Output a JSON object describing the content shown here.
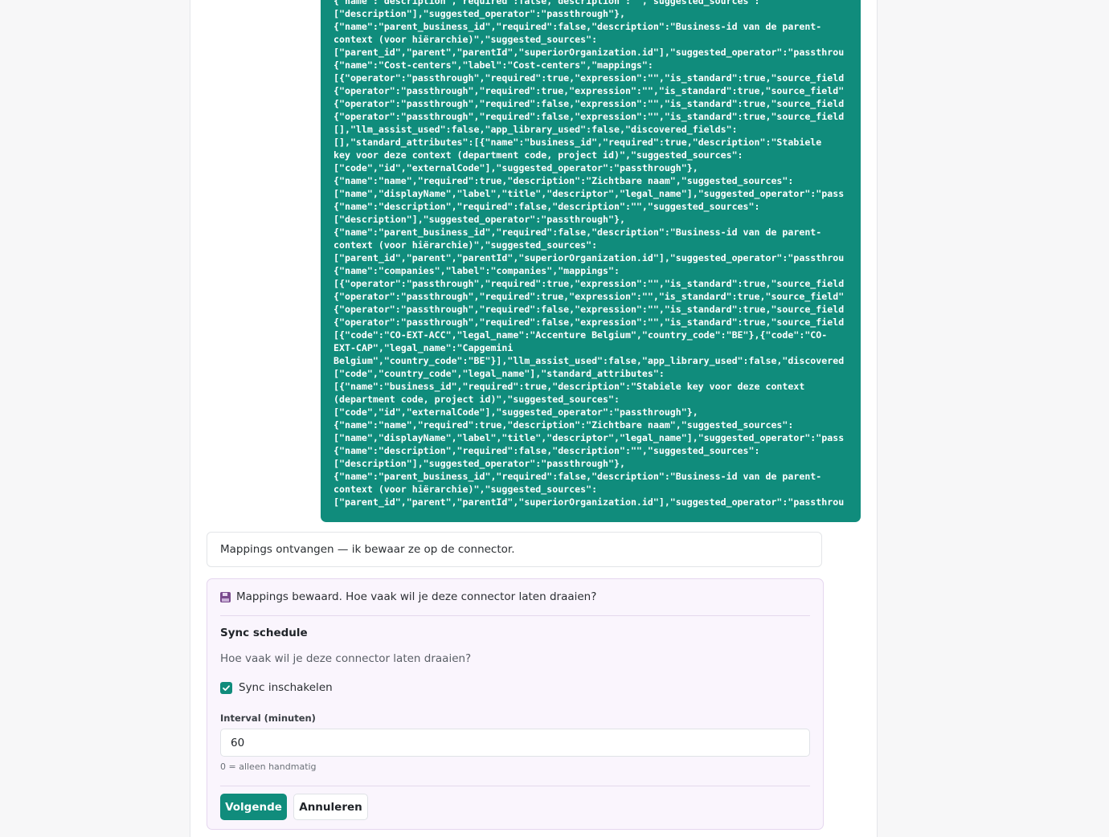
{
  "json_payload": {
    "lines": [
      "{\"name\":\"description\",\"required\":false,\"description\":\"\",\"suggested_sources\":",
      "[\"description\"],\"suggested_operator\":\"passthrough\"},",
      "{\"name\":\"parent_business_id\",\"required\":false,\"description\":\"Business-id van de parent-",
      "context (voor hiërarchie)\",\"suggested_sources\":",
      "[\"parent_id\",\"parent\",\"parentId\",\"superiorOrganization.id\"],\"suggested_operator\":\"passthrou",
      "{\"name\":\"Cost-centers\",\"label\":\"Cost-centers\",\"mappings\":",
      "[{\"operator\":\"passthrough\",\"required\":true,\"expression\":\"\",\"is_standard\":true,\"source_field",
      "{\"operator\":\"passthrough\",\"required\":true,\"expression\":\"\",\"is_standard\":true,\"source_field\"",
      "{\"operator\":\"passthrough\",\"required\":false,\"expression\":\"\",\"is_standard\":true,\"source_field",
      "{\"operator\":\"passthrough\",\"required\":false,\"expression\":\"\",\"is_standard\":true,\"source_field",
      "[],\"llm_assist_used\":false,\"app_library_used\":false,\"discovered_fields\":",
      "[],\"standard_attributes\":[{\"name\":\"business_id\",\"required\":true,\"description\":\"Stabiele",
      "key voor deze context (department code, project id)\",\"suggested_sources\":",
      "[\"code\",\"id\",\"externalCode\"],\"suggested_operator\":\"passthrough\"},",
      "{\"name\":\"name\",\"required\":true,\"description\":\"Zichtbare naam\",\"suggested_sources\":",
      "[\"name\",\"displayName\",\"label\",\"title\",\"descriptor\",\"legal_name\"],\"suggested_operator\":\"pass",
      "{\"name\":\"description\",\"required\":false,\"description\":\"\",\"suggested_sources\":",
      "[\"description\"],\"suggested_operator\":\"passthrough\"},",
      "{\"name\":\"parent_business_id\",\"required\":false,\"description\":\"Business-id van de parent-",
      "context (voor hiërarchie)\",\"suggested_sources\":",
      "[\"parent_id\",\"parent\",\"parentId\",\"superiorOrganization.id\"],\"suggested_operator\":\"passthrou",
      "{\"name\":\"companies\",\"label\":\"companies\",\"mappings\":",
      "[{\"operator\":\"passthrough\",\"required\":true,\"expression\":\"\",\"is_standard\":true,\"source_field",
      "{\"operator\":\"passthrough\",\"required\":true,\"expression\":\"\",\"is_standard\":true,\"source_field\"",
      "{\"operator\":\"passthrough\",\"required\":false,\"expression\":\"\",\"is_standard\":true,\"source_field",
      "{\"operator\":\"passthrough\",\"required\":false,\"expression\":\"\",\"is_standard\":true,\"source_field",
      "[{\"code\":\"CO-EXT-ACC\",\"legal_name\":\"Accenture Belgium\",\"country_code\":\"BE\"},{\"code\":\"CO-",
      "EXT-CAP\",\"legal_name\":\"Capgemini",
      "Belgium\",\"country_code\":\"BE\"}],\"llm_assist_used\":false,\"app_library_used\":false,\"discovered",
      "[\"code\",\"country_code\",\"legal_name\"],\"standard_attributes\":",
      "[{\"name\":\"business_id\",\"required\":true,\"description\":\"Stabiele key voor deze context",
      "(department code, project id)\",\"suggested_sources\":",
      "[\"code\",\"id\",\"externalCode\"],\"suggested_operator\":\"passthrough\"},",
      "{\"name\":\"name\",\"required\":true,\"description\":\"Zichtbare naam\",\"suggested_sources\":",
      "[\"name\",\"displayName\",\"label\",\"title\",\"descriptor\",\"legal_name\"],\"suggested_operator\":\"pass",
      "{\"name\":\"description\",\"required\":false,\"description\":\"\",\"suggested_sources\":",
      "[\"description\"],\"suggested_operator\":\"passthrough\"},",
      "{\"name\":\"parent_business_id\",\"required\":false,\"description\":\"Business-id van de parent-",
      "context (voor hiërarchie)\",\"suggested_sources\":",
      "[\"parent_id\",\"parent\",\"parentId\",\"superiorOrganization.id\"],\"suggested_operator\":\"passthrou"
    ]
  },
  "assistant_message": {
    "text": "Mappings ontvangen — ik bewaar ze op de connector."
  },
  "schedule_form": {
    "header_icon": "floppy-disk-icon",
    "header_text": "Mappings bewaard. Hoe vaak wil je deze connector laten draaien?",
    "section_title": "Sync schedule",
    "section_description": "Hoe vaak wil je deze connector laten draaien?",
    "checkbox_label": "Sync inschakelen",
    "checkbox_checked": true,
    "interval_label": "Interval (minuten)",
    "interval_value": "60",
    "interval_hint": "0 = alleen handmatig",
    "next_button": "Volgende",
    "cancel_button": "Annuleren"
  },
  "colors": {
    "accent": "#108c7c",
    "card_background": "#faf5fd",
    "page_background": "#f7f7f8"
  }
}
